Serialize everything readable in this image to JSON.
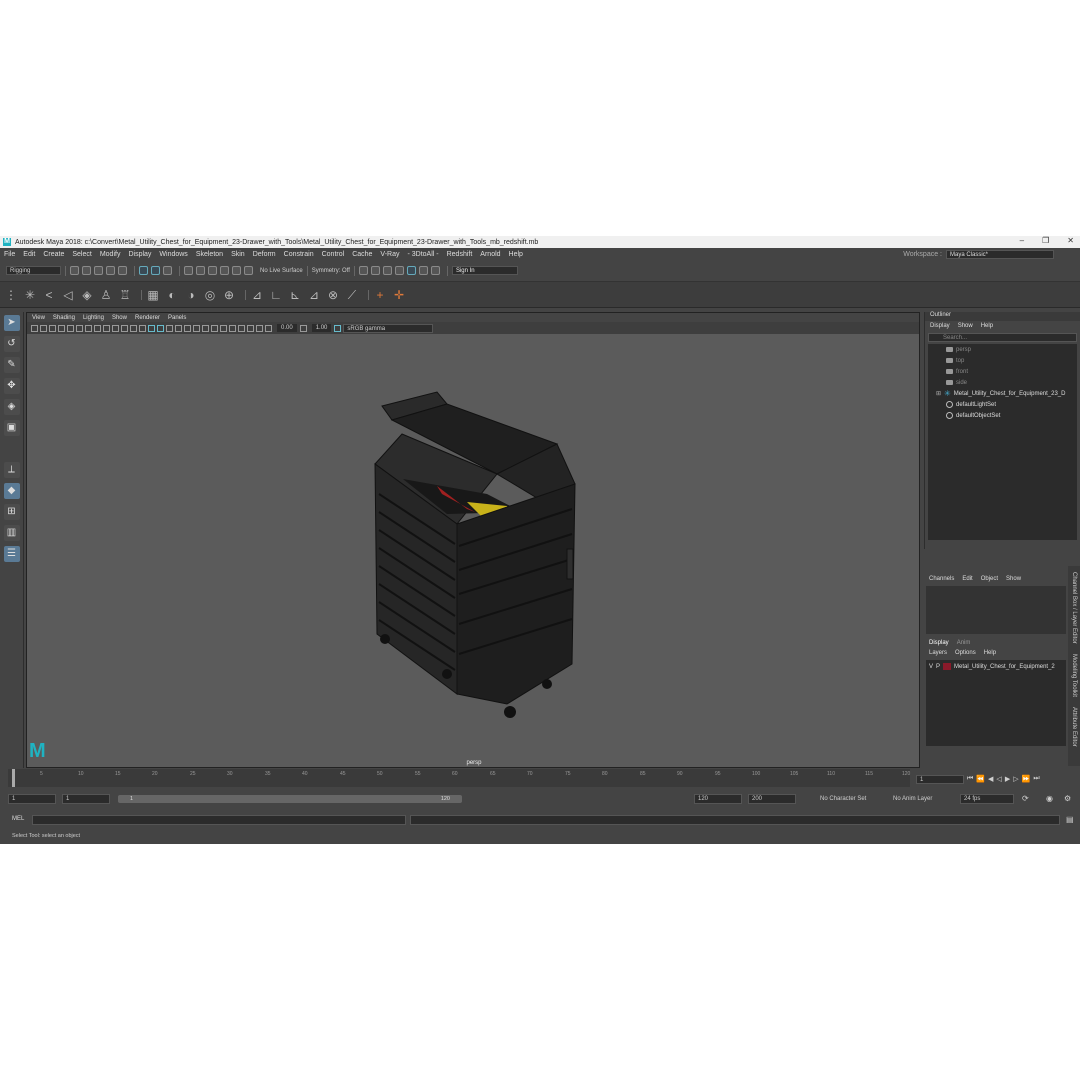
{
  "window": {
    "title": "Autodesk Maya 2018: c:\\Convert\\Metal_Utility_Chest_for_Equipment_23-Drawer_with_Tools\\Metal_Utility_Chest_for_Equipment_23-Drawer_with_Tools_mb_redshift.mb",
    "min": "–",
    "max": "❐",
    "close": "✕"
  },
  "menu": {
    "items": [
      "File",
      "Edit",
      "Create",
      "Select",
      "Modify",
      "Display",
      "Windows",
      "Skeleton",
      "Skin",
      "Deform",
      "Constrain",
      "Control",
      "Cache",
      "V-Ray",
      "- 3DtoAll -",
      "Redshift",
      "Arnold",
      "Help"
    ],
    "workspace_label": "Workspace :",
    "workspace_value": "Maya Classic*"
  },
  "status": {
    "mode": "Rigging",
    "live_surface": "No Live Surface",
    "symmetry": "Symmetry: Off",
    "sign_in": "Sign In"
  },
  "viewport": {
    "menu": [
      "View",
      "Shading",
      "Lighting",
      "Show",
      "Renderer",
      "Panels"
    ],
    "exposure": "0.00",
    "gamma": "1.00",
    "colorspace": "sRGB gamma",
    "camera_label": "persp",
    "logo": "M"
  },
  "outliner": {
    "title": "Outliner",
    "menu": [
      "Display",
      "Show",
      "Help"
    ],
    "search_placeholder": "Search...",
    "items": [
      {
        "label": "persp",
        "kind": "cam",
        "dim": true
      },
      {
        "label": "top",
        "kind": "cam",
        "dim": true
      },
      {
        "label": "front",
        "kind": "cam",
        "dim": true
      },
      {
        "label": "side",
        "kind": "cam",
        "dim": true
      },
      {
        "label": "Metal_Utility_Chest_for_Equipment_23_D",
        "kind": "joint",
        "dim": false
      },
      {
        "label": "defaultLightSet",
        "kind": "set",
        "dim": false
      },
      {
        "label": "defaultObjectSet",
        "kind": "set",
        "dim": false
      }
    ]
  },
  "channels": {
    "menu": [
      "Channels",
      "Edit",
      "Object",
      "Show"
    ]
  },
  "layers": {
    "tabs": [
      "Display",
      "Anim"
    ],
    "menu": [
      "Layers",
      "Options",
      "Help"
    ],
    "row": {
      "vis": "V",
      "playback": "P",
      "name": "Metal_Utility_Chest_for_Equipment_2",
      "color": "#8a1a2a"
    }
  },
  "side_tabs": [
    "Channel Box / Layer Editor",
    "Modeling Toolkit",
    "Attribute Editor"
  ],
  "timeline": {
    "ticks": [
      "5",
      "10",
      "15",
      "20",
      "25",
      "30",
      "35",
      "40",
      "45",
      "50",
      "55",
      "60",
      "65",
      "70",
      "75",
      "80",
      "85",
      "90",
      "95",
      "100",
      "105",
      "110",
      "115",
      "120"
    ],
    "current": "1"
  },
  "range": {
    "start": "1",
    "start2": "1",
    "slider_start": "1",
    "slider_end": "120",
    "end": "120",
    "end2": "200",
    "char_set": "No Character Set",
    "anim_layer": "No Anim Layer",
    "fps": "24 fps"
  },
  "command": {
    "label": "MEL"
  },
  "helpline": "Select Tool: select an object"
}
